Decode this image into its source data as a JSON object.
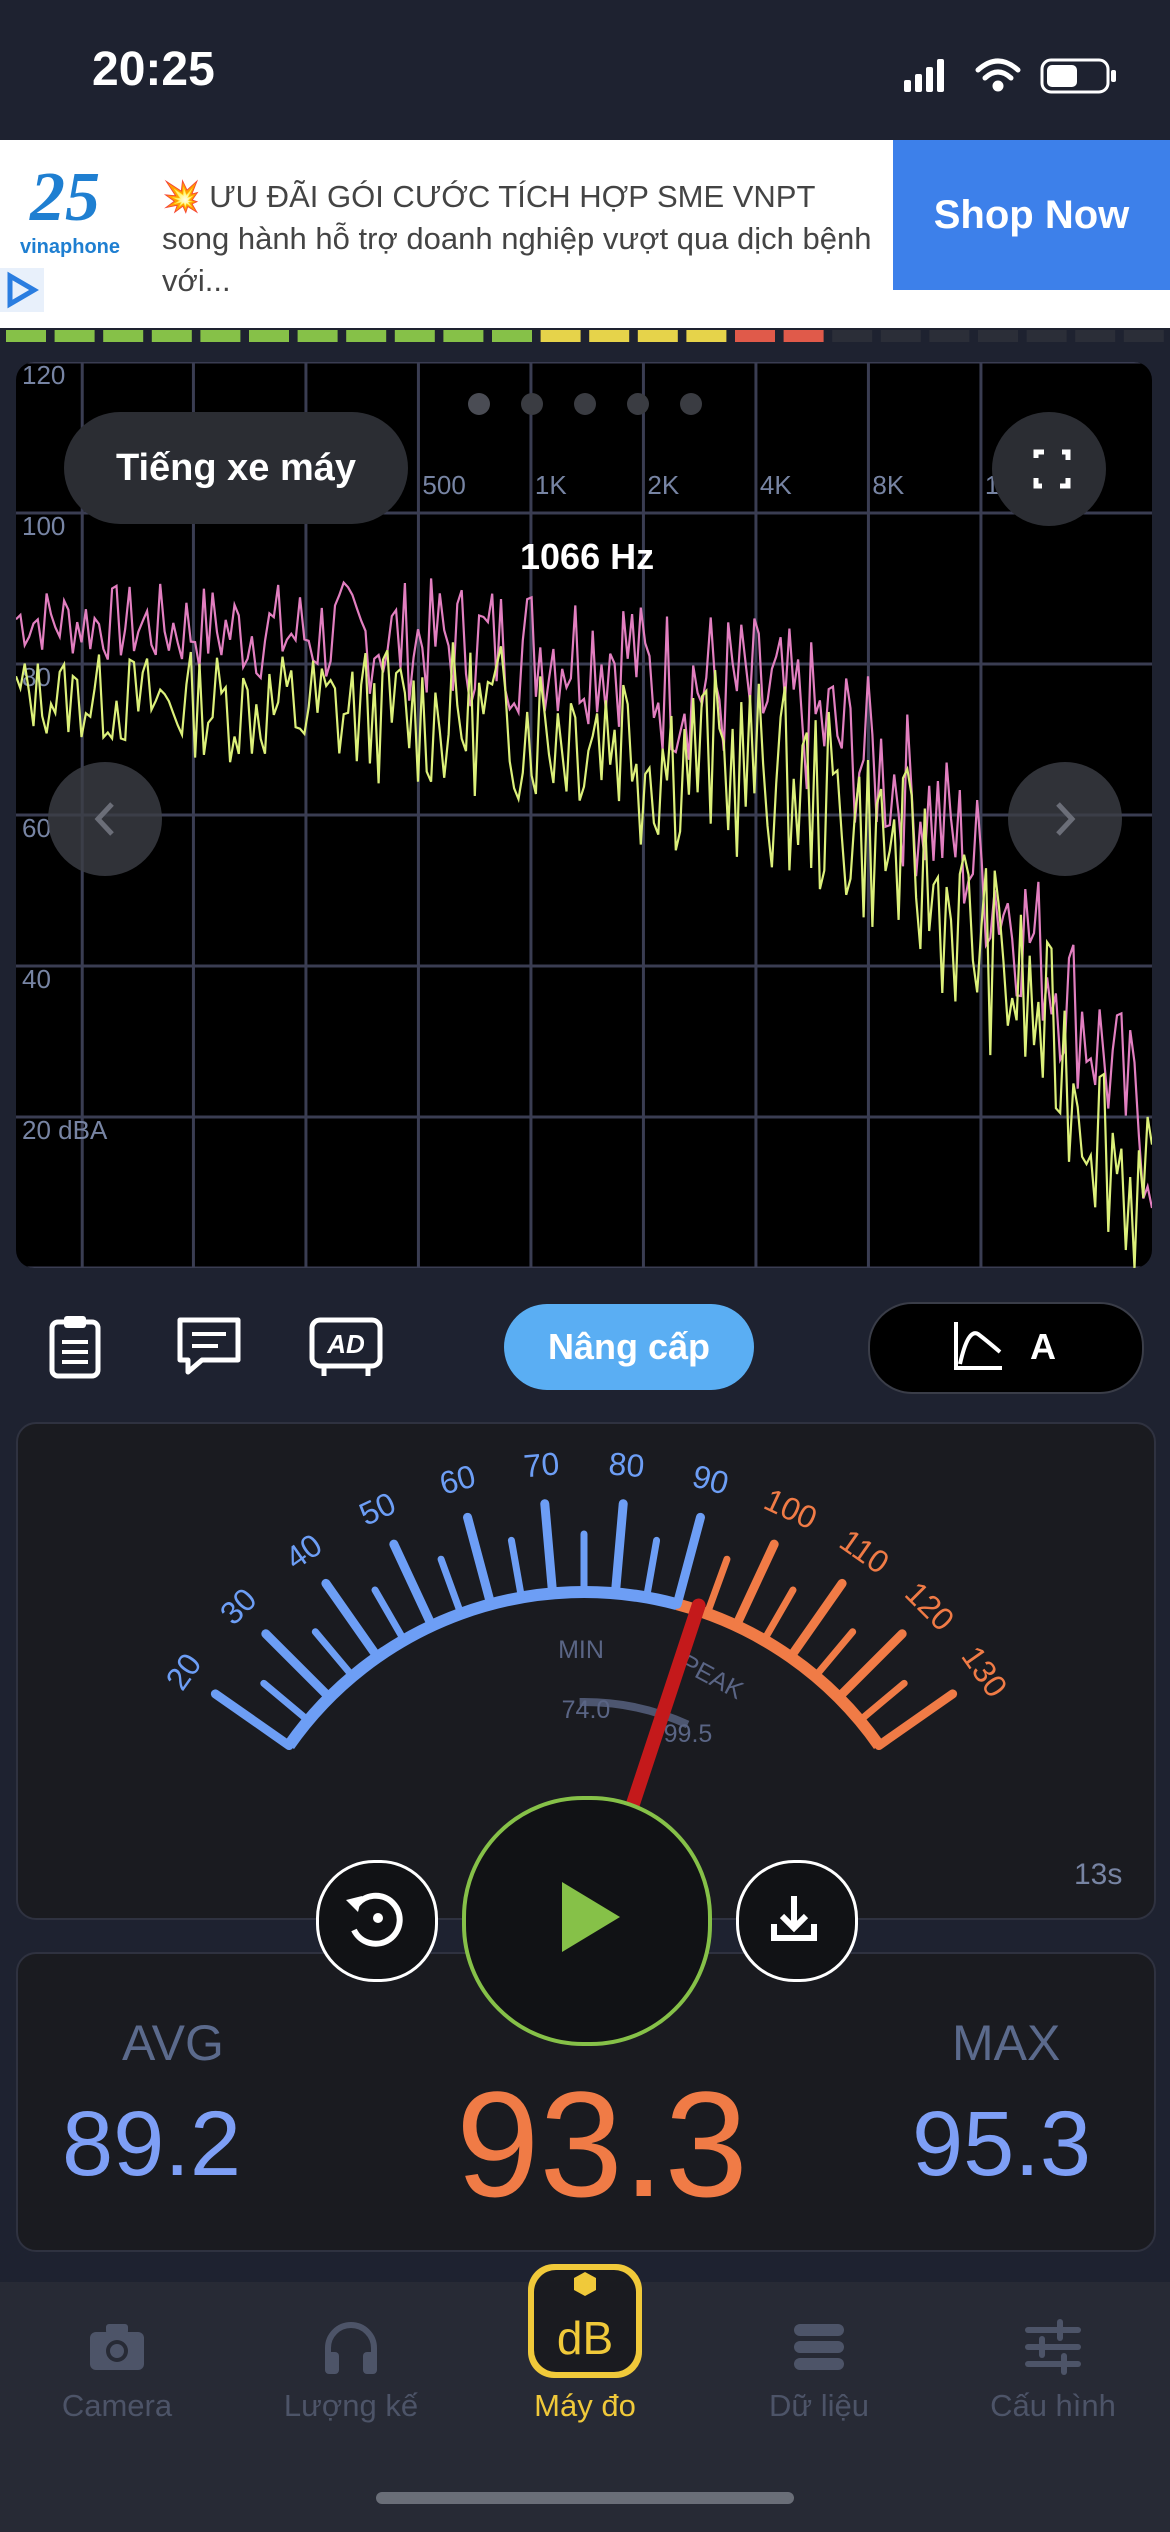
{
  "status_bar": {
    "time": "20:25"
  },
  "ad": {
    "badge": "25",
    "brand": "vinaphone",
    "text": "💥 ƯU ĐÃI GÓI CƯỚC TÍCH HỢP SME VNPT song hành hỗ trợ doanh nghiệp vượt qua dịch bệnh với...",
    "cta": "Shop Now"
  },
  "spectrum": {
    "preset": "Tiếng xe máy",
    "peak_freq_label": "1066 Hz",
    "y_ticks": [
      "120",
      "100",
      "80",
      "60",
      "40",
      "20 dBA"
    ],
    "x_ticks": [
      "500",
      "1K",
      "2K",
      "4K",
      "8K",
      "16K"
    ],
    "page_count": 5,
    "active_page": 0,
    "colors": {
      "peak_line": "#e27fc0",
      "current_line": "#dcf07a",
      "grid": "#3a3d52"
    }
  },
  "toolbar": {
    "icons": [
      "clipboard-icon",
      "comment-icon",
      "ad-remove-icon"
    ],
    "upgrade_label": "Nâng cấp",
    "weighting": "A"
  },
  "gauge": {
    "scale": [
      "20",
      "30",
      "40",
      "50",
      "60",
      "70",
      "80",
      "90",
      "100",
      "110",
      "120",
      "130"
    ],
    "min_label": "MIN",
    "min_value": "74.0",
    "peak_label": "PEAK",
    "peak_value": "99.5",
    "needle_db": 93.3,
    "timer": "13s",
    "colors": {
      "normal": "#6d9ef5",
      "loud": "#f07b46",
      "needle": "#c4191b"
    }
  },
  "stats": {
    "avg_label": "AVG",
    "avg_value": "89.2",
    "current_value": "93.3",
    "max_label": "MAX",
    "max_value": "95.3"
  },
  "tabs": [
    {
      "label": "Camera",
      "icon": "camera-icon"
    },
    {
      "label": "Lượng kế",
      "icon": "headphones-icon"
    },
    {
      "label": "Máy đo",
      "icon": "db-meter-icon",
      "active": true
    },
    {
      "label": "Dữ liệu",
      "icon": "database-icon"
    },
    {
      "label": "Cấu hình",
      "icon": "sliders-icon"
    }
  ]
}
